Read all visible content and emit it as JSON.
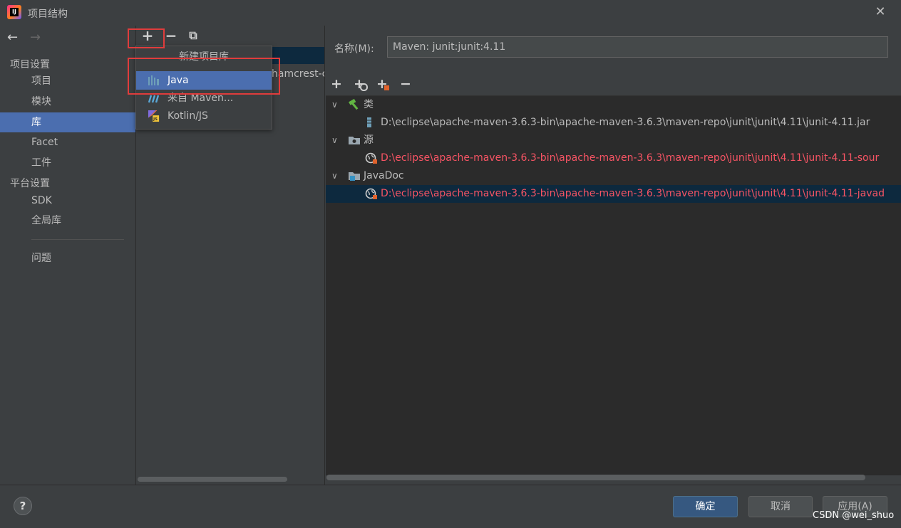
{
  "window": {
    "title": "项目结构",
    "close": "✕",
    "app_icon_text": "IJ"
  },
  "sidebar": {
    "back": "←",
    "forward": "→",
    "section_project": "项目设置",
    "items_project": [
      "项目",
      "模块",
      "库",
      "Facet",
      "工件"
    ],
    "section_platform": "平台设置",
    "items_platform": [
      "SDK",
      "全局库"
    ],
    "problems": "问题",
    "active": "库"
  },
  "middle": {
    "add": "+",
    "remove": "−",
    "copy": "⧉",
    "row2_text": "hamcrest-c"
  },
  "popup": {
    "title": "新建项目库",
    "items": [
      "Java",
      "来自 Maven...",
      "Kotlin/JS"
    ]
  },
  "right": {
    "name_label": "名称(M):",
    "name_value": "Maven: junit:junit:4.11",
    "tools": [
      "+",
      "+",
      "+",
      "−"
    ],
    "tree": [
      {
        "label": "类",
        "kind": "node"
      },
      {
        "label": "D:\\eclipse\\apache-maven-3.6.3-bin\\apache-maven-3.6.3\\maven-repo\\junit\\junit\\4.11\\junit-4.11.jar",
        "kind": "leaf"
      },
      {
        "label": "源",
        "kind": "node"
      },
      {
        "label": "D:\\eclipse\\apache-maven-3.6.3-bin\\apache-maven-3.6.3\\maven-repo\\junit\\junit\\4.11\\junit-4.11-sour",
        "kind": "leaf-error"
      },
      {
        "label": "JavaDoc",
        "kind": "node"
      },
      {
        "label": "D:\\eclipse\\apache-maven-3.6.3-bin\\apache-maven-3.6.3\\maven-repo\\junit\\junit\\4.11\\junit-4.11-javad",
        "kind": "leaf-error"
      }
    ]
  },
  "footer": {
    "help": "?",
    "ok": "确定",
    "cancel": "取消",
    "apply": "应用(A)",
    "watermark": "CSDN @wei_shuo"
  },
  "colors": {
    "accent": "#4b6eaf",
    "error_text": "#f75464",
    "highlight_box": "#e03c3c"
  }
}
